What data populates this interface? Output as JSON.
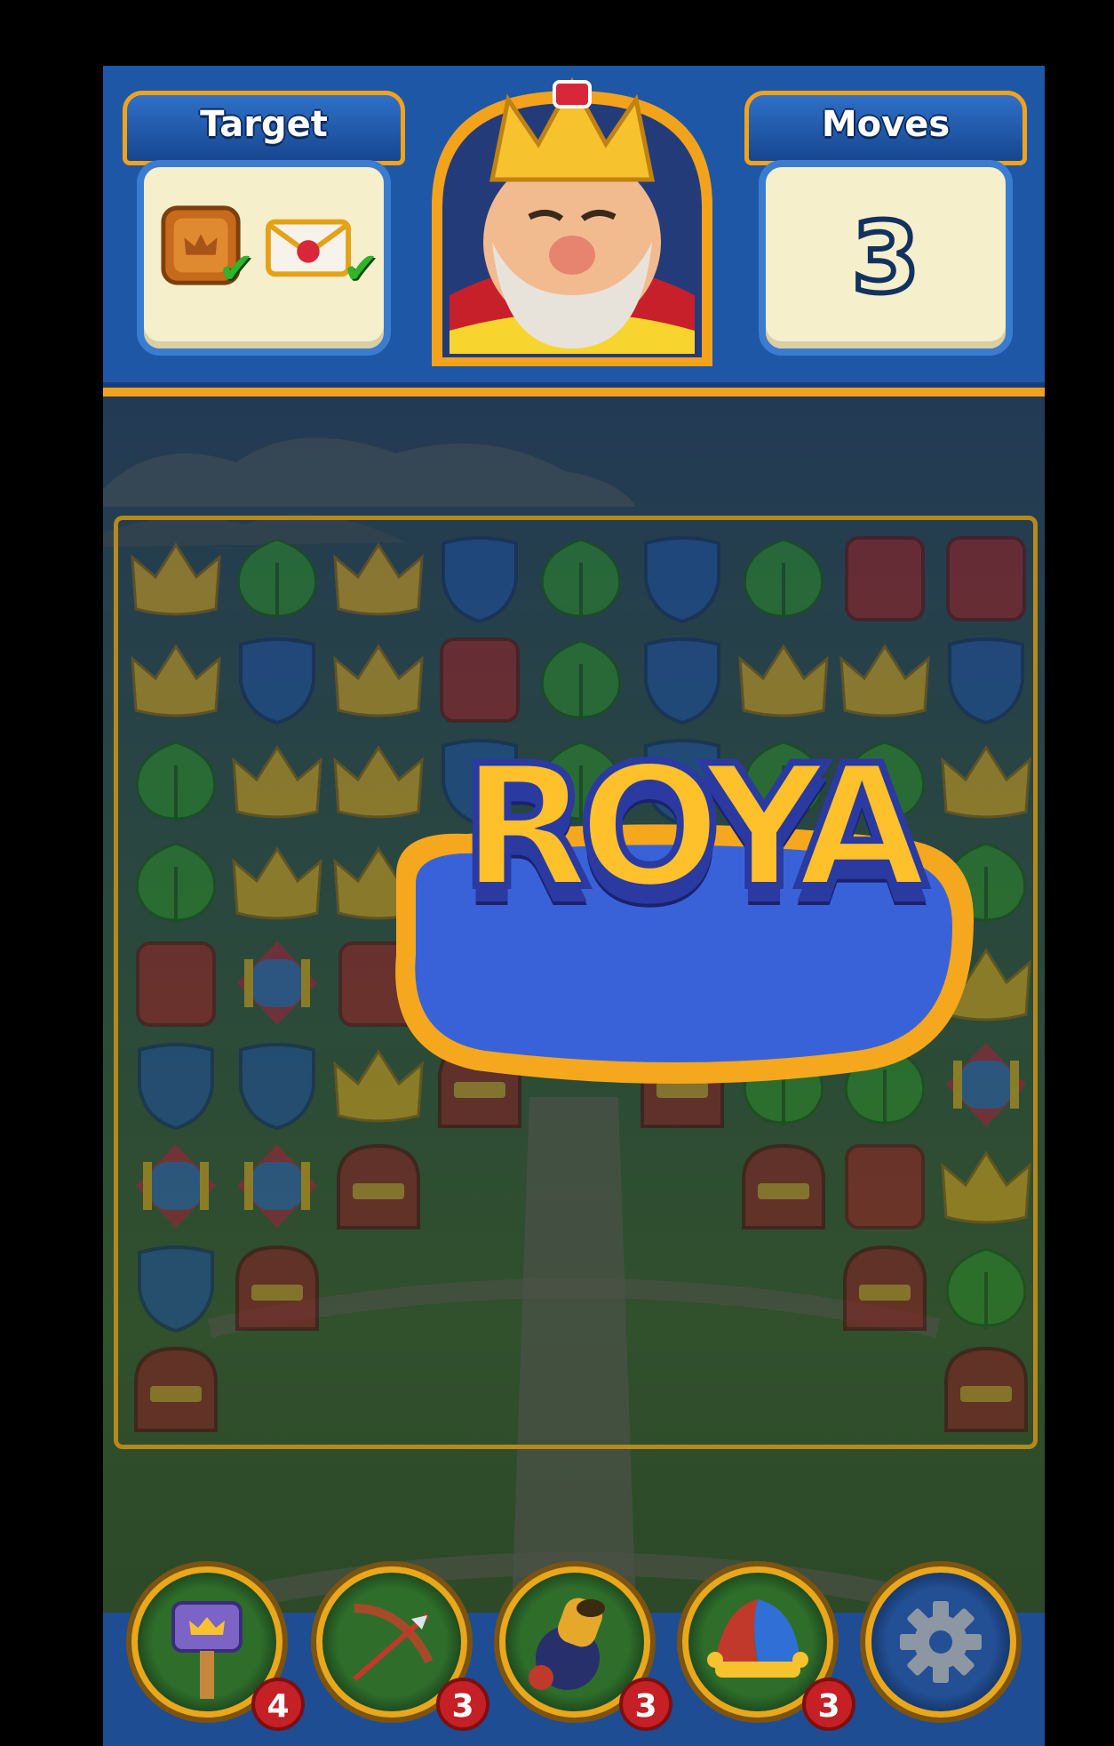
{
  "hud": {
    "target_label": "Target",
    "moves_label": "Moves",
    "moves_value": "3",
    "targets": [
      {
        "icon": "crown-crate-icon",
        "completed": true
      },
      {
        "icon": "envelope-icon",
        "completed": true
      }
    ]
  },
  "logo": {
    "text": "ROYA"
  },
  "boosters": [
    {
      "icon": "hammer-icon",
      "count": "4"
    },
    {
      "icon": "arrow-icon",
      "count": "3"
    },
    {
      "icon": "cannon-icon",
      "count": "3"
    },
    {
      "icon": "jester-hat-icon",
      "count": "3"
    },
    {
      "icon": "settings-gear-icon",
      "count": null
    }
  ],
  "colors": {
    "hud_blue": "#1e57a6",
    "gold": "#f3a21c",
    "panel_cream": "#f6efcc"
  }
}
